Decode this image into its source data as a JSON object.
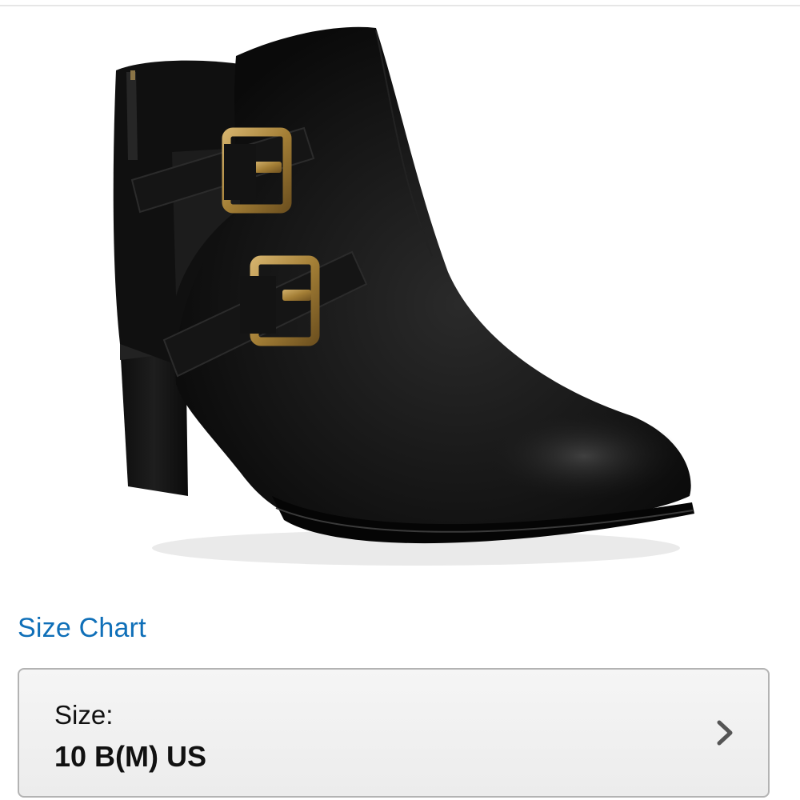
{
  "product": {
    "image_subject": "black suede ankle boot with two brass buckle straps",
    "icon": "black-ankle-boot-image"
  },
  "size_chart": {
    "label": "Size Chart"
  },
  "size_selector": {
    "label": "Size:",
    "value": "10 B(M) US",
    "icon": "chevron-right-icon"
  },
  "colors": {
    "link": "#0f6fb8",
    "selector_border": "#b3b3b3",
    "selector_bg": "#efefef",
    "text": "#111111",
    "brass": "#b08a3e"
  }
}
